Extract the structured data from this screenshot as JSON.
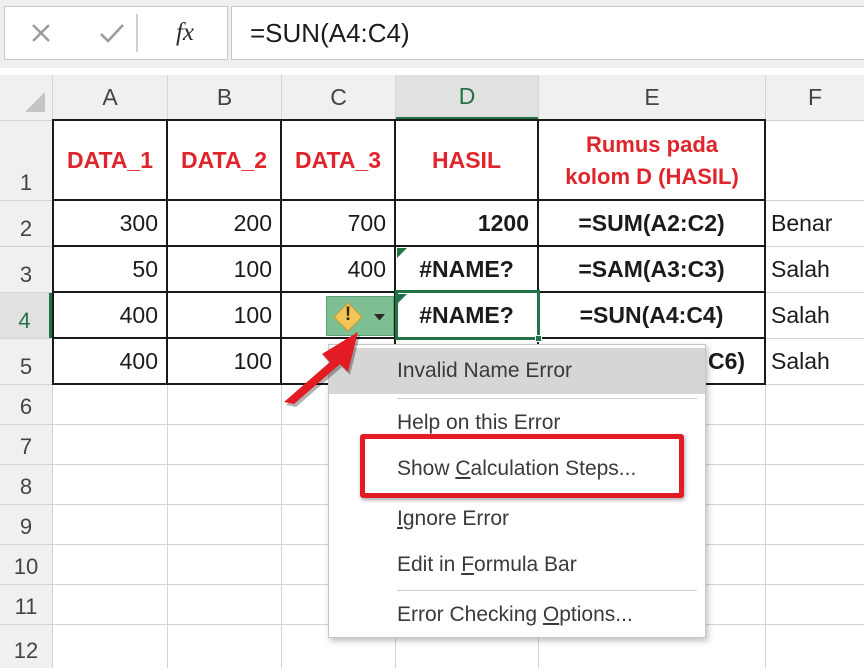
{
  "formula_bar": {
    "cancel_icon": "close-icon",
    "enter_icon": "checkmark-icon",
    "fx_label": "fx",
    "formula": "=SUN(A4:C4)"
  },
  "columns": [
    "A",
    "B",
    "C",
    "D",
    "E",
    "F"
  ],
  "selected_column": "D",
  "rows": [
    "1",
    "2",
    "3",
    "4",
    "5",
    "6",
    "7",
    "8",
    "9",
    "10",
    "11",
    "12"
  ],
  "selected_row": "4",
  "headers": {
    "a": "DATA_1",
    "b": "DATA_2",
    "c": "DATA_3",
    "d": "HASIL",
    "e_line1": "Rumus pada",
    "e_line2": "kolom D (HASIL)"
  },
  "data_rows": [
    {
      "a": "300",
      "b": "200",
      "c": "700",
      "d": "1200",
      "e": "=SUM(A2:C2)",
      "f": "Benar"
    },
    {
      "a": "50",
      "b": "100",
      "c": "400",
      "d": "#NAME?",
      "e": "=SAM(A3:C3)",
      "f": "Salah"
    },
    {
      "a": "400",
      "b": "100",
      "c": "",
      "d": "#NAME?",
      "e": "=SUN(A4:C4)",
      "f": "Salah"
    },
    {
      "a": "400",
      "b": "100",
      "c": "",
      "d": "",
      "e": "C6)",
      "f": "Salah"
    }
  ],
  "error_smart_tag": {
    "symbol": "!",
    "icon": "warning-diamond-icon",
    "dropdown_icon": "dropdown-triangle-icon"
  },
  "context_menu": {
    "title": "Invalid Name Error",
    "items": [
      {
        "pre": "Help on this Error",
        "u": "",
        "post": ""
      },
      {
        "pre": "Show ",
        "u": "C",
        "post": "alculation Steps..."
      },
      {
        "pre": "",
        "u": "I",
        "post": "gnore Error"
      },
      {
        "pre": "Edit in ",
        "u": "F",
        "post": "ormula Bar"
      },
      {
        "pre": "Error Checking ",
        "u": "O",
        "post": "ptions..."
      }
    ]
  },
  "annotations": {
    "arrow_color": "#e31b23",
    "highlight_box_color": "#e31b23"
  },
  "colors": {
    "header_text": "#e0242b",
    "excel_green": "#217346",
    "smart_tag_bg": "#7fbf94"
  }
}
